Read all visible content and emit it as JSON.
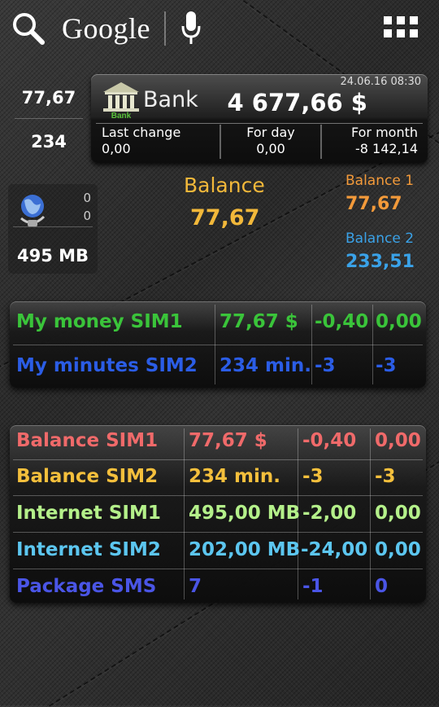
{
  "search_bar": {
    "brand": "Google",
    "icons": [
      "search-icon",
      "mic-icon",
      "apps-grid-icon"
    ]
  },
  "left_widget": {
    "value_top": "77,67",
    "value_bottom": "234"
  },
  "bank": {
    "name": "Bank",
    "icon_text": "Bank",
    "datetime": "24.06.16 08:30",
    "total": "4 677,66 $",
    "columns": [
      {
        "label": "Last change",
        "value": "0,00"
      },
      {
        "label": "For day",
        "value": "0,00"
      },
      {
        "label": "For month",
        "value": "-8 142,14"
      }
    ]
  },
  "data_widget": {
    "zero1": "0",
    "zero2": "0",
    "traffic": "495 MB"
  },
  "balance": {
    "label": "Balance",
    "value": "77,67"
  },
  "balance1": {
    "label": "Balance 1",
    "value": "77,67"
  },
  "balance2": {
    "label": "Balance 2",
    "value": "233,51"
  },
  "table1": {
    "rows": [
      {
        "name": "My money SIM1",
        "value": "77,67 $",
        "delta": "-0,40",
        "extra": "0,00",
        "color": "#3ac43a"
      },
      {
        "name": "My minutes SIM2",
        "value": "234 min.",
        "delta": "-3",
        "extra": "-3",
        "color": "#2b5de6"
      }
    ]
  },
  "table2": {
    "rows": [
      {
        "name": "Balance SIM1",
        "value": "77,67 $",
        "delta": "-0,40",
        "extra": "0,00",
        "color": "#f06a6a"
      },
      {
        "name": "Balance SIM2",
        "value": "234 min.",
        "delta": "-3",
        "extra": "-3",
        "color": "#f4bf3c"
      },
      {
        "name": "Internet SIM1",
        "value": "495,00 MB",
        "delta": "-2,00",
        "extra": "0,00",
        "color": "#b4f08a"
      },
      {
        "name": "Internet SIM2",
        "value": "202,00 MB",
        "delta": "-24,00",
        "extra": "0,00",
        "color": "#5cc6f0"
      },
      {
        "name": "Package SMS",
        "value": "7",
        "delta": "-1",
        "extra": "0",
        "color": "#4a55e6"
      }
    ]
  }
}
